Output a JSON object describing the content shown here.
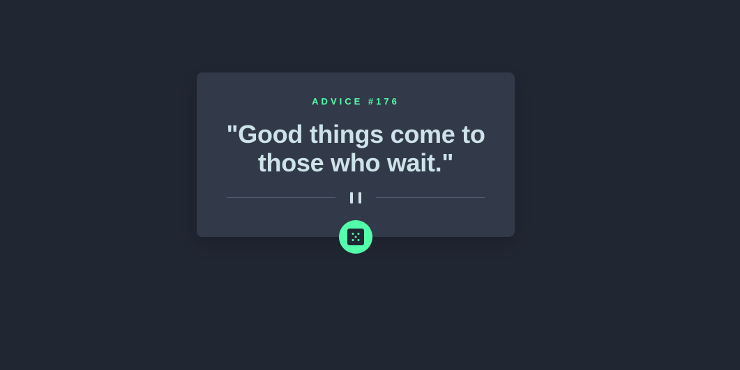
{
  "advice": {
    "id_label": "ADVICE #176",
    "quote": "\"Good things come to those who wait.\""
  },
  "controls": {
    "generate_icon": "dice-icon",
    "divider_icon": "pause-icon"
  },
  "colors": {
    "background": "#202632",
    "card": "#323a49",
    "accent": "#53ffaa",
    "text": "#cee3e9",
    "divider": "#4f5d74"
  }
}
